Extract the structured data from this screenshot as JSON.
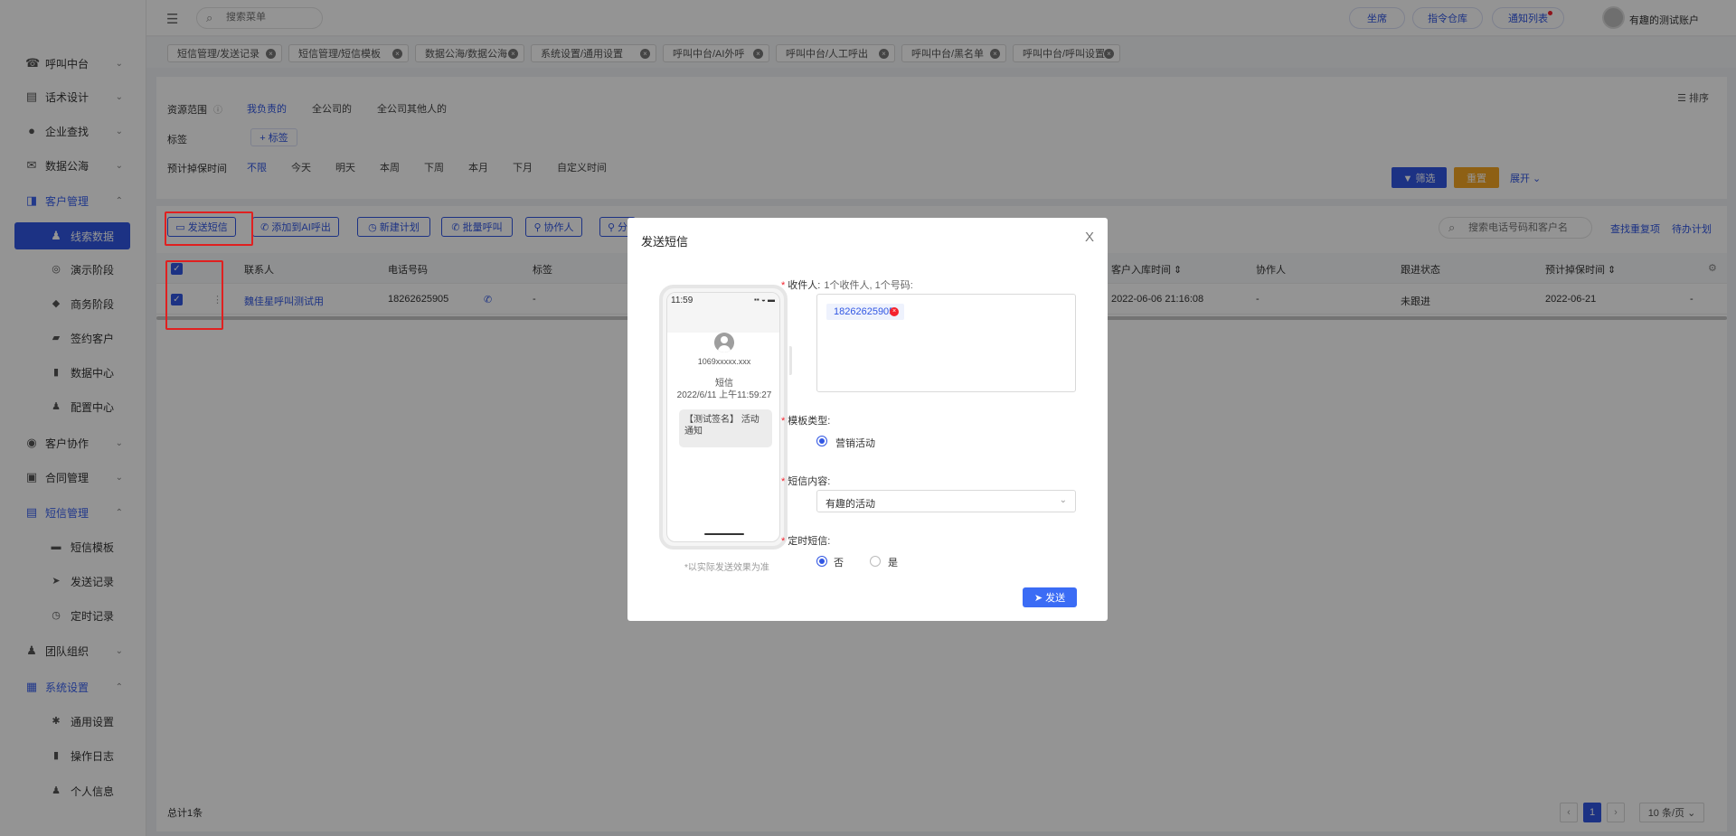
{
  "sidebar": {
    "items": [
      {
        "label": "呼叫中台",
        "icon": "phone-desk-icon",
        "glyph": "☎",
        "chevron": "⌄"
      },
      {
        "label": "话术设计",
        "icon": "script-book-icon",
        "glyph": "▤",
        "chevron": "⌄"
      },
      {
        "label": "企业查找",
        "icon": "lightbulb-icon",
        "glyph": "●",
        "chevron": "⌄"
      },
      {
        "label": "数据公海",
        "icon": "mail-icon",
        "glyph": "✉",
        "chevron": "⌄"
      },
      {
        "label": "客户管理",
        "icon": "customer-icon",
        "glyph": "◨",
        "chevron": "⌃"
      },
      {
        "label": "线索数据",
        "icon": "user-lead-icon",
        "glyph": "♟"
      },
      {
        "label": "演示阶段",
        "icon": "target-icon",
        "glyph": "◎"
      },
      {
        "label": "商务阶段",
        "icon": "diamond-icon",
        "glyph": "◆"
      },
      {
        "label": "签约客户",
        "icon": "contract-icon",
        "glyph": "▰"
      },
      {
        "label": "数据中心",
        "icon": "bar-chart-icon",
        "glyph": "▮"
      },
      {
        "label": "配置中心",
        "icon": "user-config-icon",
        "glyph": "♟"
      },
      {
        "label": "客户协作",
        "icon": "collab-icon",
        "glyph": "◉",
        "chevron": "⌄"
      },
      {
        "label": "合同管理",
        "icon": "briefcase-icon",
        "glyph": "▣",
        "chevron": "⌄"
      },
      {
        "label": "短信管理",
        "icon": "sms-icon",
        "glyph": "▤",
        "chevron": "⌃"
      },
      {
        "label": "短信模板",
        "icon": "template-icon",
        "glyph": "▬"
      },
      {
        "label": "发送记录",
        "icon": "send-icon",
        "glyph": "➤"
      },
      {
        "label": "定时记录",
        "icon": "clock-icon",
        "glyph": "◷"
      },
      {
        "label": "团队组织",
        "icon": "team-icon",
        "glyph": "♟",
        "chevron": "⌄"
      },
      {
        "label": "系统设置",
        "icon": "grid-icon",
        "glyph": "▦",
        "chevron": "⌃"
      },
      {
        "label": "通用设置",
        "icon": "gear-icon",
        "glyph": "✱"
      },
      {
        "label": "操作日志",
        "icon": "log-icon",
        "glyph": "▮"
      },
      {
        "label": "个人信息",
        "icon": "person-icon",
        "glyph": "♟"
      }
    ]
  },
  "topbar": {
    "menu_glyph": "☰",
    "search_glyph": "⌕",
    "search_placeholder": "搜索菜单",
    "seat": "坐席",
    "commands": "指令仓库",
    "notices": "通知列表",
    "user": "有趣的测试账户"
  },
  "tabs": [
    "短信管理/发送记录",
    "短信管理/短信模板",
    "数据公海/数据公海",
    "系统设置/通用设置",
    "呼叫中台/AI外呼",
    "呼叫中台/人工呼出",
    "呼叫中台/黑名单",
    "呼叫中台/呼叫设置"
  ],
  "filters": {
    "scope_label": "资源范围",
    "scope_help": "ⓘ",
    "scope_options": [
      "我负责的",
      "全公司的",
      "全公司其他人的"
    ],
    "tag_label": "标签",
    "tag_add": "+ 标签",
    "date_label": "预计掉保时间",
    "date_options": [
      "不限",
      "今天",
      "明天",
      "本周",
      "下周",
      "本月",
      "下月",
      "自定义时间"
    ],
    "sort": "☰ 排序",
    "filter_btn": "▼ 筛选",
    "reset_btn": "重置",
    "expand_btn": "展开 ⌄"
  },
  "actions": {
    "send_sms": "▭ 发送短信",
    "add_ai": "✆ 添加到AI呼出",
    "new_plan": "◷ 新建计划",
    "batch_call": "✆ 批量呼叫",
    "collaborator": "⚲ 协作人",
    "assign": "⚲ 分",
    "search_glyph": "⌕",
    "search_placeholder": "搜索电话号码和客户名",
    "find_dup": "查找重复项",
    "todo_plan": "待办计划"
  },
  "table": {
    "headers": {
      "contact": "联系人",
      "phone": "电话号码",
      "tag": "标签",
      "in_time": "客户入库时间 ⇕",
      "collab": "协作人",
      "status": "跟进状态",
      "expire": "预计掉保时间 ⇕"
    },
    "rows": [
      {
        "contact": "魏佳星呼叫测试用",
        "phone": "18262625905",
        "tag": "-",
        "in_time": "2022-06-06 21:16:08",
        "collab": "-",
        "status": "未跟进",
        "expire": "2022-06-21",
        "extra": "-"
      }
    ],
    "total": "总计1条",
    "page": "1",
    "page_size": "10 条/页 ⌄",
    "prev": "‹",
    "next": "›"
  },
  "modal": {
    "title": "发送短信",
    "close": "X",
    "phone_preview": {
      "time": "11:59",
      "status_icons": "▪▪ ◒ ▬",
      "sender": "1069xxxxx.xxx",
      "kind": "短信",
      "sent_time": "2022/6/11 上午11:59:27",
      "message": "【测试签名】 活动通知",
      "note": "*以实际发送效果为准"
    },
    "recipient_label": "收件人:",
    "recipient_hint": "1个收件人, 1个号码:",
    "recipient_chip": "18262625905",
    "recipient_remove": "×",
    "template_type_label": "模板类型:",
    "template_type_option": "营销活动",
    "content_label": "短信内容:",
    "content_value": "有趣的活动",
    "content_arrow": "⌄",
    "scheduled_label": "定时短信:",
    "scheduled_no": "否",
    "scheduled_yes": "是",
    "send_btn": "➤ 发送"
  },
  "colors": {
    "primary": "#3157e3",
    "warning": "#f5a623",
    "danger": "#e02020"
  }
}
